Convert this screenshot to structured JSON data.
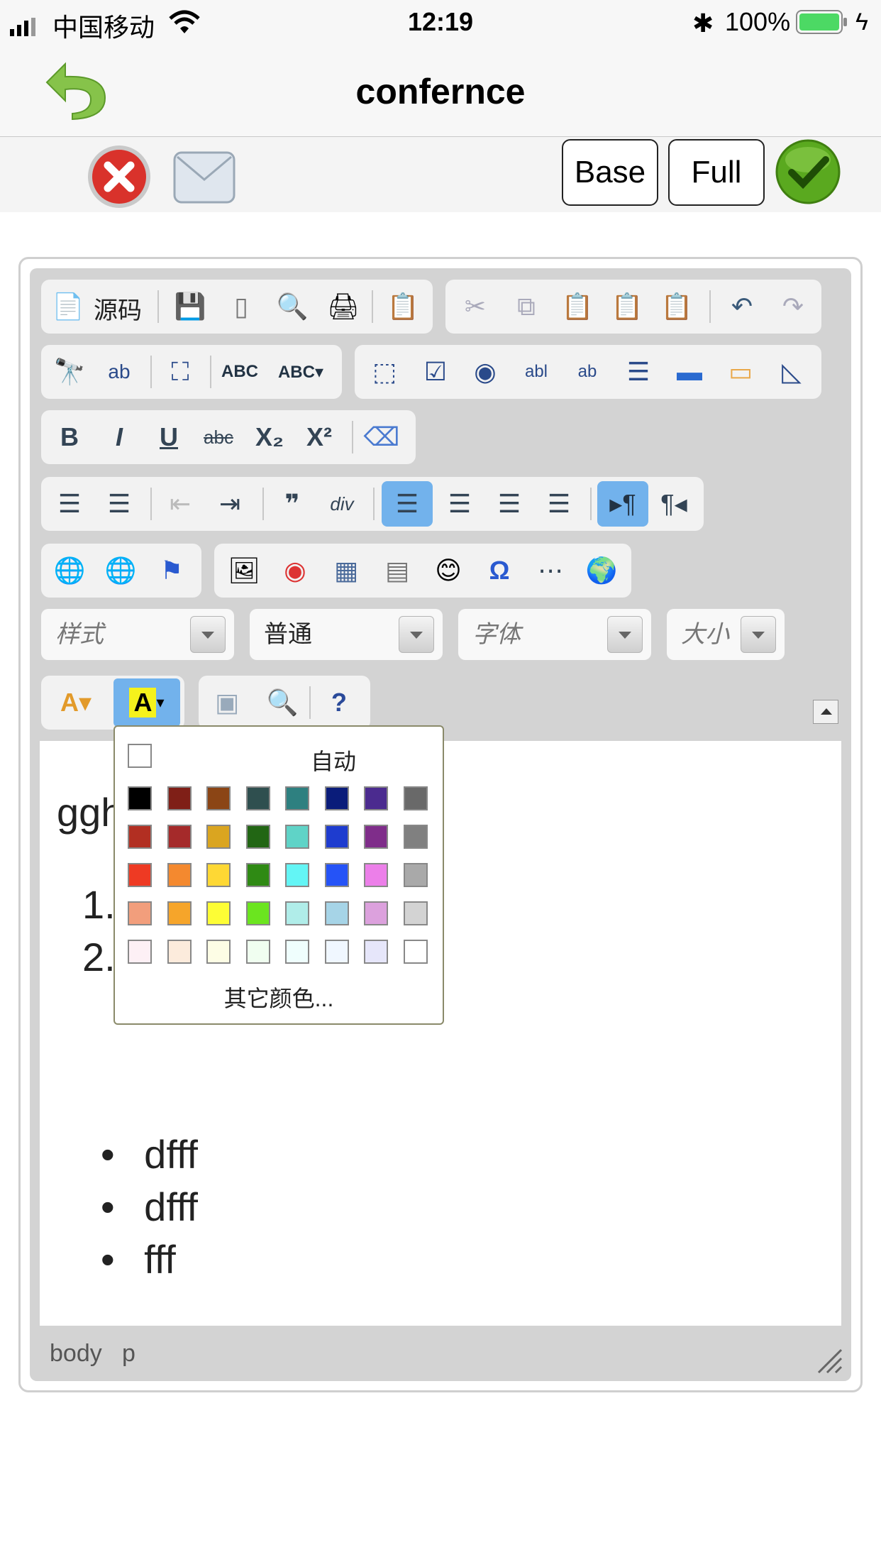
{
  "status": {
    "carrier": "中国移动",
    "time": "12:19",
    "battery": "100%"
  },
  "nav": {
    "title": "confernce"
  },
  "actions": {
    "base_label": "Base",
    "full_label": "Full"
  },
  "toolbar": {
    "source_label": "源码",
    "style_placeholder": "样式",
    "format_value": "普通",
    "font_placeholder": "字体",
    "size_placeholder": "大小"
  },
  "content": {
    "first_line": "ggh",
    "numbers": [
      "1.",
      "2."
    ],
    "bullets": [
      "dfff",
      "dfff",
      "fff"
    ]
  },
  "pathbar": {
    "items": [
      "body",
      "p"
    ]
  },
  "color_panel": {
    "auto_label": "自动",
    "more_label": "其它颜色...",
    "rows": [
      [
        "#000000",
        "#7f1f17",
        "#8b4515",
        "#2f4f4f",
        "#2e8080",
        "#0a1c7a",
        "#4b2b8f",
        "#696969"
      ],
      [
        "#b22f22",
        "#a52a2a",
        "#daa520",
        "#226614",
        "#5fd3c7",
        "#1e3ccf",
        "#7f2d8a",
        "#808080"
      ],
      [
        "#ee3a23",
        "#f4892f",
        "#fed834",
        "#2f8a14",
        "#63f5f5",
        "#2553f7",
        "#ec7fe9",
        "#a9a9a9"
      ],
      [
        "#f29e7c",
        "#f6a52a",
        "#fdfd35",
        "#6be51f",
        "#b0ede9",
        "#a6d4e7",
        "#dca1dd",
        "#d3d3d3"
      ],
      [
        "#fdf0f5",
        "#fcebdc",
        "#fdfde5",
        "#f0fef0",
        "#effefd",
        "#f0f7ff",
        "#e6e6fa",
        "#ffffff"
      ]
    ]
  },
  "colors": {
    "accent": "#72b2ec",
    "chrome": "#d3d3d3"
  }
}
